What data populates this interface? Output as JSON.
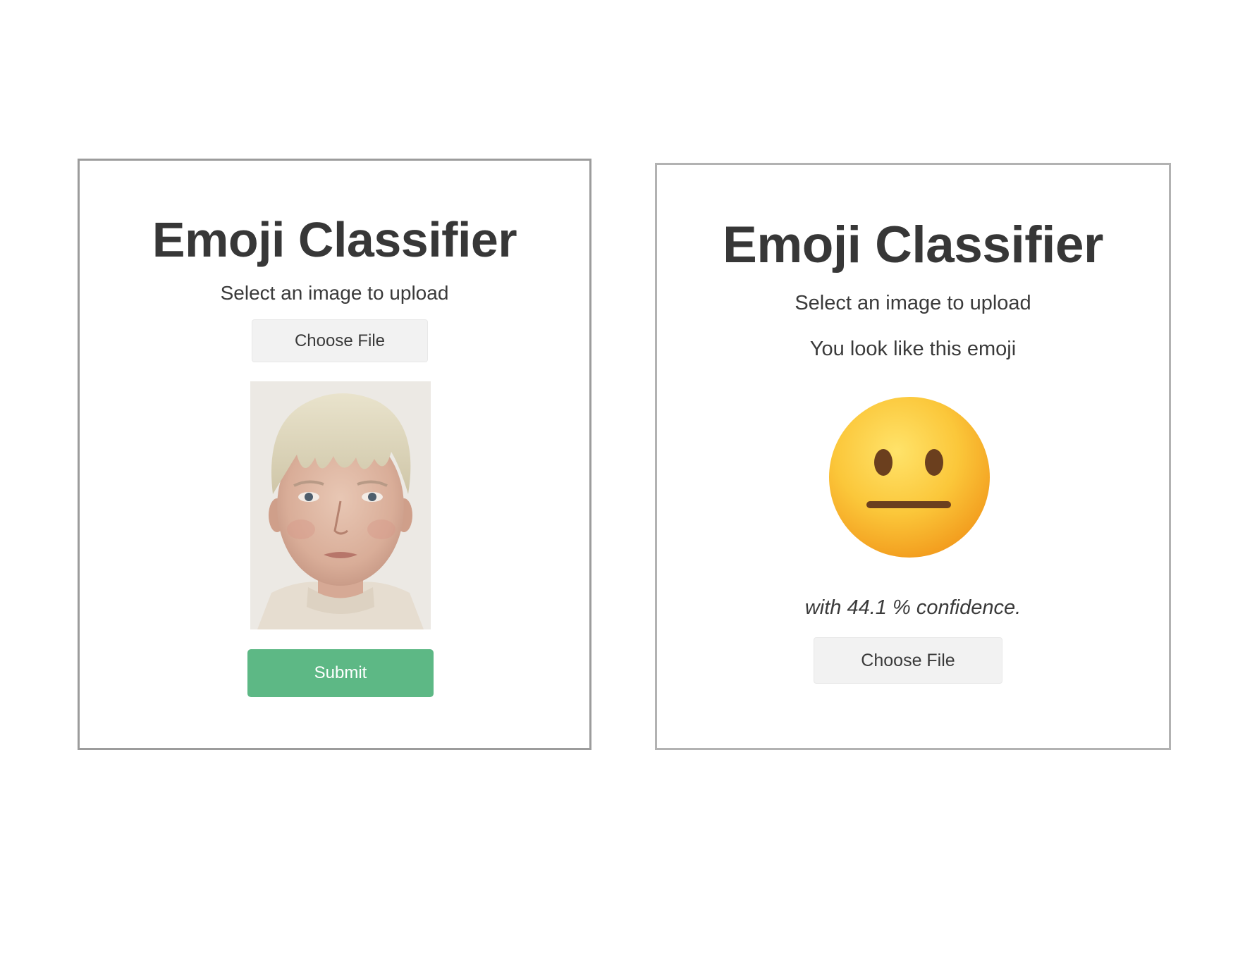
{
  "left_panel": {
    "title": "Emoji Classifier",
    "subtitle": "Select an image to upload",
    "choose_file_label": "Choose File",
    "submit_label": "Submit"
  },
  "right_panel": {
    "title": "Emoji Classifier",
    "subtitle": "Select an image to upload",
    "result_label": "You look like this emoji",
    "confidence_text": "with 44.1 % confidence.",
    "choose_file_label": "Choose File",
    "emoji_icon": "neutral-face-icon"
  },
  "colors": {
    "submit_button": "#5db885",
    "choose_button": "#f2f2f2",
    "panel_border": "#9c9c9c",
    "title_text": "#373737"
  }
}
